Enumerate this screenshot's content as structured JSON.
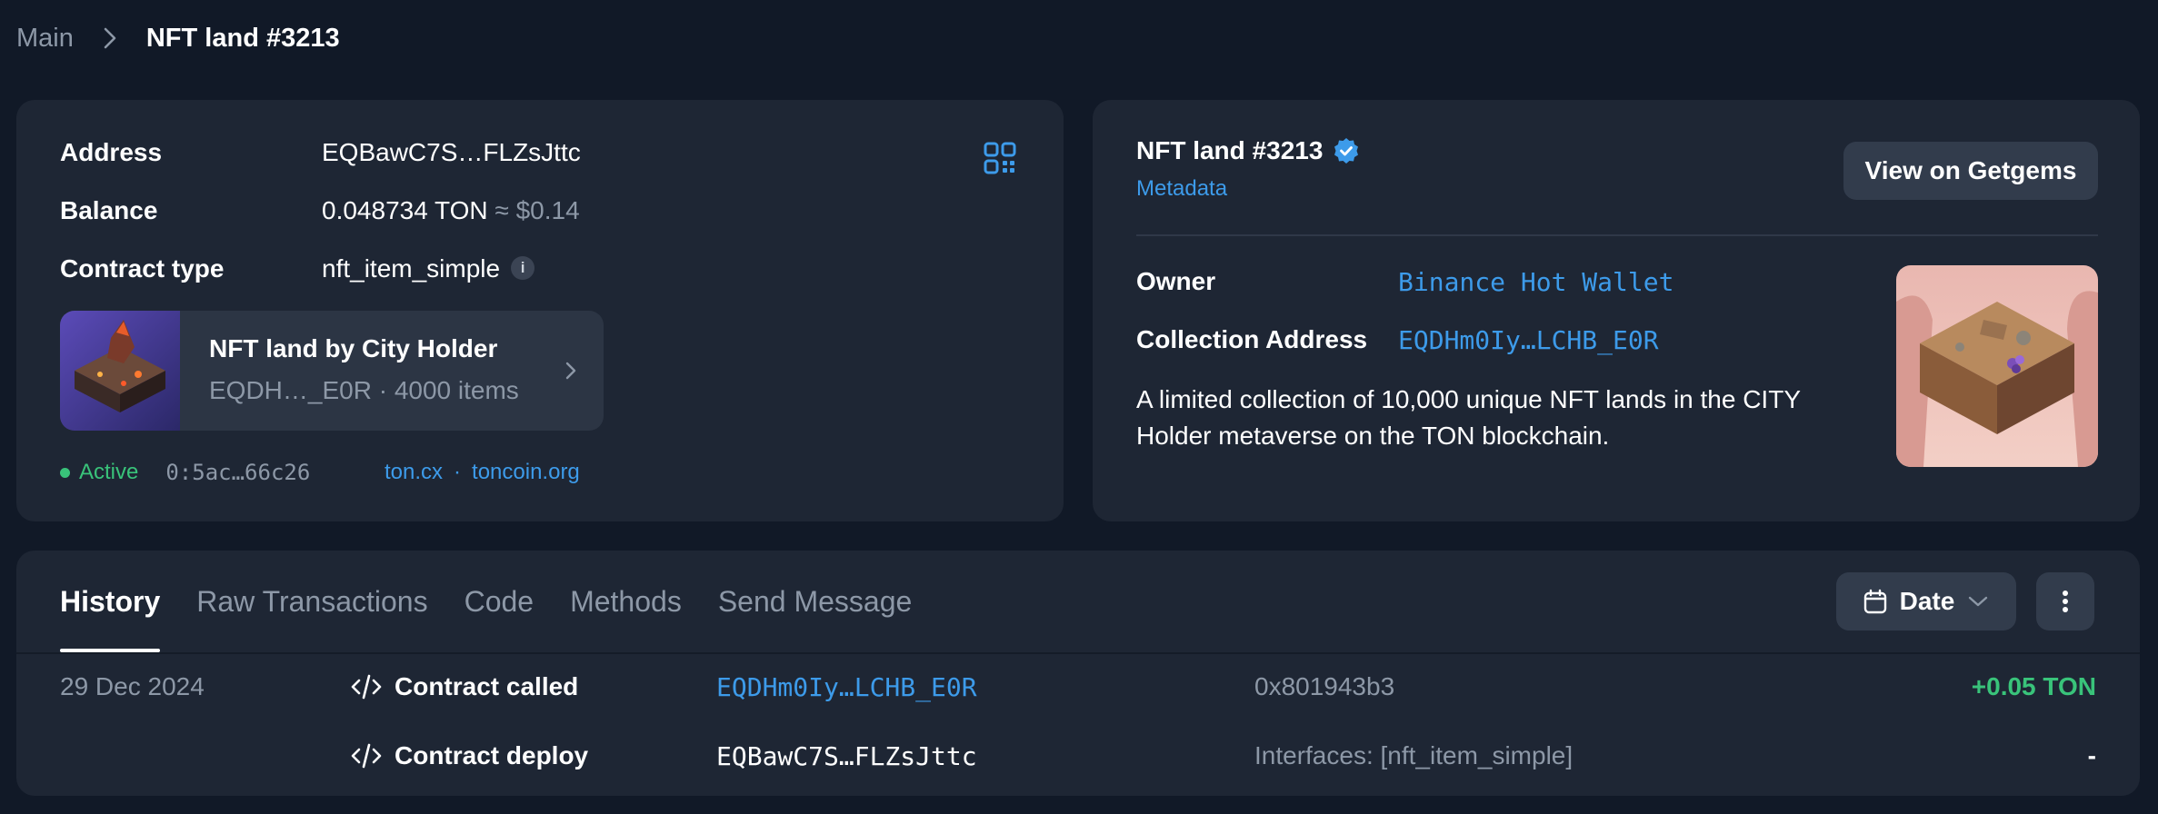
{
  "breadcrumb": {
    "main": "Main",
    "current": "NFT land #3213"
  },
  "account": {
    "address_label": "Address",
    "address_value": "EQBawC7S…FLZsJttc",
    "balance_label": "Balance",
    "balance_value": "0.048734 TON",
    "balance_fiat": "≈ $0.14",
    "contract_type_label": "Contract type",
    "contract_type_value": "nft_item_simple",
    "info_icon_glyph": "i",
    "collection": {
      "title": "NFT land by City Holder",
      "subtitle": "EQDH…_E0R · 4000 items"
    },
    "status": "Active",
    "raw_address": "0:5ac…66c26",
    "links": [
      "ton.cx",
      "toncoin.org"
    ],
    "links_separator": "·"
  },
  "nft": {
    "title": "NFT land #3213",
    "metadata_link": "Metadata",
    "getgems_button": "View on Getgems",
    "owner_label": "Owner",
    "owner_value": "Binance Hot Wallet",
    "collection_label": "Collection Address",
    "collection_value": "EQDHm0Iy…LCHB_E0R",
    "description": "A limited collection of 10,000 unique NFT lands in the CITY Holder metaverse on the TON blockchain."
  },
  "history": {
    "tabs": [
      "History",
      "Raw Transactions",
      "Code",
      "Methods",
      "Send Message"
    ],
    "active_tab": "History",
    "date_button": "Date",
    "rows": [
      {
        "date": "29 Dec 2024",
        "action": "Contract called",
        "address": "EQDHm0Iy…LCHB_E0R",
        "address_is_link": true,
        "detail": "0x801943b3",
        "amount": "+0.05 TON",
        "amount_color": "#39c37a"
      },
      {
        "date": "",
        "action": "Contract deploy",
        "address": "EQBawC7S…FLZsJttc",
        "address_is_link": false,
        "detail": "Interfaces: [nft_item_simple]",
        "amount": "-",
        "amount_color": "#ffffff"
      }
    ]
  },
  "colors": {
    "background": "#111927",
    "card": "#1e2634",
    "accent_link": "#3d9bea",
    "success": "#39c37a",
    "muted_text": "#8d98a7"
  },
  "icons": [
    "chevron-right-icon",
    "qr-code-icon",
    "info-icon",
    "verified-badge-icon",
    "code-icon",
    "calendar-icon",
    "chevron-down-icon",
    "more-vertical-icon"
  ]
}
